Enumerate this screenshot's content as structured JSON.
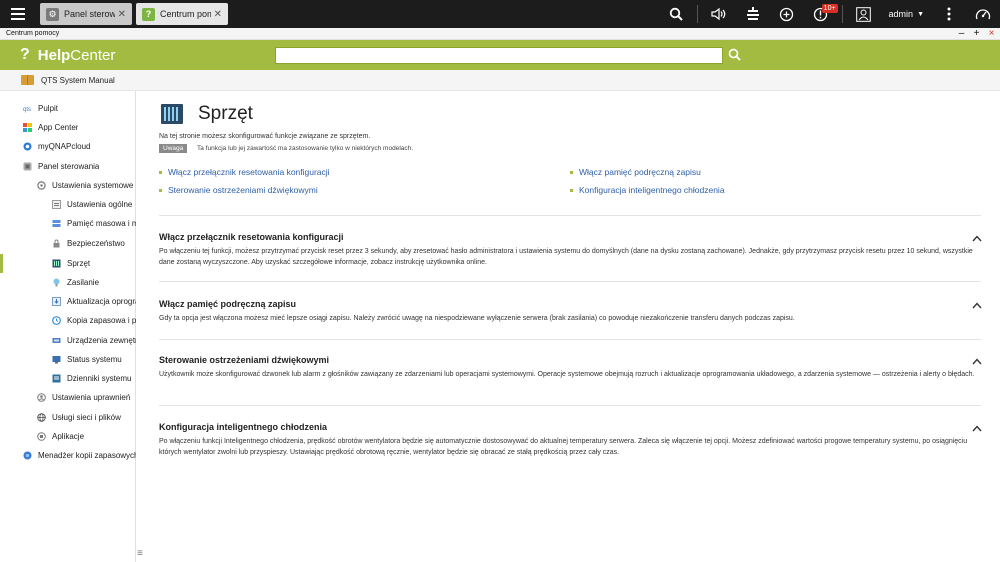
{
  "topbar": {
    "tabs": [
      {
        "label": "Panel sterowania",
        "icon": "gear-icon"
      },
      {
        "label": "Centrum pomocy",
        "icon": "help-icon"
      }
    ],
    "notification_badge": "10+",
    "user": "admin"
  },
  "window": {
    "title": "Centrum pomocy",
    "controls": [
      "–",
      "+",
      "×"
    ]
  },
  "help": {
    "logo_bold": "Help",
    "logo_light": "Center",
    "search_placeholder": ""
  },
  "manual": {
    "label": "QTS System Manual"
  },
  "sidebar": {
    "items": [
      {
        "label": "Pulpit",
        "icon": "desktop-icon"
      },
      {
        "label": "App Center",
        "icon": "app-center-icon"
      },
      {
        "label": "myQNAPcloud",
        "icon": "cloud-icon"
      },
      {
        "label": "Panel sterowania",
        "icon": "control-panel-icon"
      },
      {
        "label": "Ustawienia systemowe",
        "icon": "gear-icon"
      },
      {
        "label": "Ustawienia ogólne",
        "icon": "settings-icon"
      },
      {
        "label": "Pamięć masowa i migawki",
        "icon": "storage-icon"
      },
      {
        "label": "Bezpieczeństwo",
        "icon": "lock-icon"
      },
      {
        "label": "Sprzęt",
        "icon": "hardware-icon"
      },
      {
        "label": "Zasilanie",
        "icon": "power-icon"
      },
      {
        "label": "Aktualizacja oprogramowania",
        "icon": "update-icon"
      },
      {
        "label": "Kopia zapasowa i przywracanie",
        "icon": "backup-icon"
      },
      {
        "label": "Urządzenia zewnętrzne",
        "icon": "external-device-icon"
      },
      {
        "label": "Status systemu",
        "icon": "status-icon"
      },
      {
        "label": "Dzienniki systemu",
        "icon": "logs-icon"
      },
      {
        "label": "Ustawienia uprawnień",
        "icon": "user-icon"
      },
      {
        "label": "Usługi sieci i plików",
        "icon": "globe-icon"
      },
      {
        "label": "Aplikacje",
        "icon": "apps-icon"
      },
      {
        "label": "Menadżer kopii zapasowych",
        "icon": "backup-manager-icon"
      }
    ]
  },
  "page": {
    "title": "Sprzęt",
    "intro": "Na tej stronie możesz skonfigurować funkcje związane ze sprzętem.",
    "note_badge": "Uwaga",
    "note_text": "Ta funkcja lub jej zawartość ma zastosowanie tylko w niektórych modelach.",
    "toc": [
      "Włącz przełącznik resetowania konfiguracji",
      "Sterowanie ostrzeżeniami dźwiękowymi",
      "Włącz pamięć podręczną zapisu",
      "Konfiguracja inteligentnego chłodzenia"
    ],
    "sections": [
      {
        "title": "Włącz przełącznik resetowania konfiguracji",
        "body": "Po włączeniu tej funkcji, możesz przytrzymać przycisk reset przez 3 sekundy, aby zresetować hasło administratora i ustawienia systemu do domyślnych (dane na dysku zostaną zachowane). Jednakże, gdy przytrzymasz przycisk resetu przez 10 sekund, wszystkie dane zostaną wyczyszczone. Aby uzyskać szczegółowe informacje, zobacz instrukcję użytkownika online."
      },
      {
        "title": "Włącz pamięć podręczną zapisu",
        "body": "Gdy ta opcja jest włączona możesz mieć lepsze osiągi zapisu. Należy zwrócić uwagę na niespodziewane wyłączenie serwera (brak zasilania) co powoduje niezakończenie transferu danych podczas zapisu."
      },
      {
        "title": "Sterowanie ostrzeżeniami dźwiękowymi",
        "body": "Użytkownik może skonfigurować dzwonek lub alarm z głośników zawiązany ze zdarzeniami lub operacjami systemowymi. Operacje systemowe obejmują rozruch i aktualizacje oprogramowania układowego, a zdarzenia systemowe — ostrzeżenia i alerty o błędach."
      },
      {
        "title": "Konfiguracja inteligentnego chłodzenia",
        "body": "Po włączeniu funkcji Inteligentnego chłodzenia, prędkość obrotów wentylatora będzie się automatycznie dostosowywać do aktualnej temperatury serwera. Zaleca się włączenie tej opcji. Możesz zdefiniować wartości progowe temperatury systemu, po osiągnięciu których wentylator zwolni lub przyspieszy. Ustawiając prędkość obrotową ręcznie, wentylator będzie się obracać ze stałą prędkością przez cały czas."
      }
    ]
  },
  "colors": {
    "accent": "#a3bb40",
    "link": "#2e5fa8",
    "topbar": "#1c1c1c"
  }
}
